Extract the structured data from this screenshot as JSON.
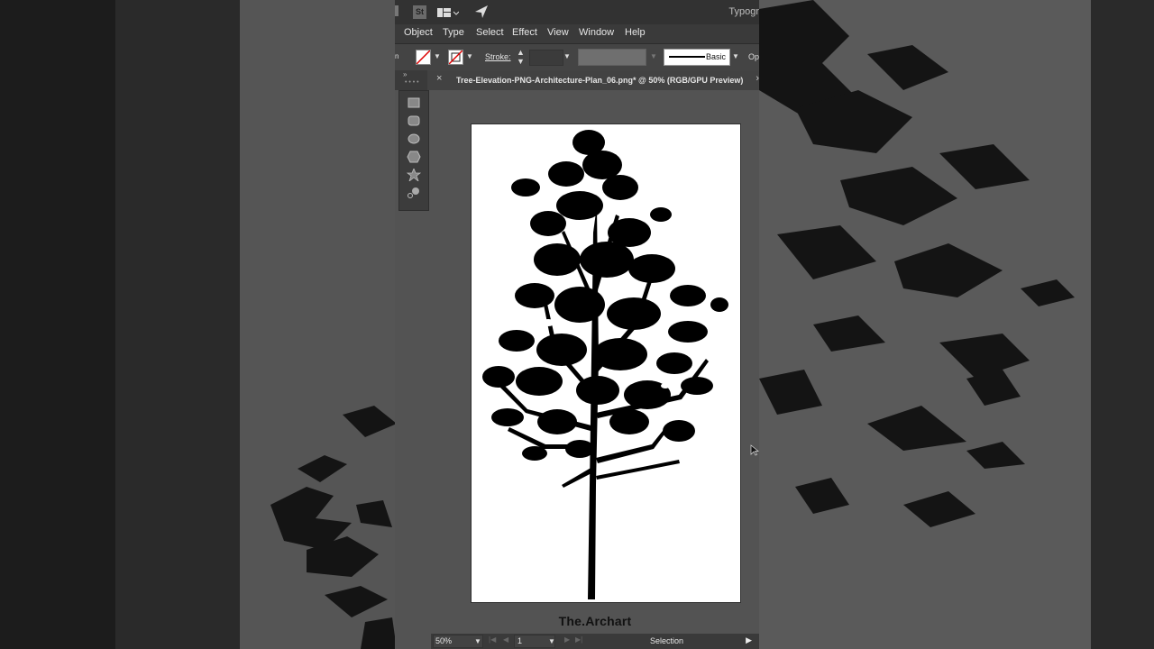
{
  "window": {
    "title_partial": "Typogr"
  },
  "menu": {
    "items": [
      "Object",
      "Type",
      "Select",
      "Effect",
      "View",
      "Window",
      "Help"
    ]
  },
  "control_bar": {
    "stroke_label": "Stroke:",
    "brush_label": "Basic",
    "opacity_label_partial": "Op"
  },
  "document": {
    "tab_title": "Tree-Elevation-PNG-Architecture-Plan_06.png* @ 50% (RGB/GPU Preview)"
  },
  "tools": [
    "rectangle-tool",
    "rounded-rectangle-tool",
    "ellipse-tool",
    "polygon-tool",
    "star-tool",
    "flare-tool"
  ],
  "canvas": {
    "watermark": "The.Archart"
  },
  "status_bar": {
    "zoom": "50%",
    "artboard": "1",
    "current_tool": "Selection"
  },
  "colors": {
    "app_background": "#535353",
    "artboard": "#ffffff",
    "silhouette": "#000000"
  }
}
